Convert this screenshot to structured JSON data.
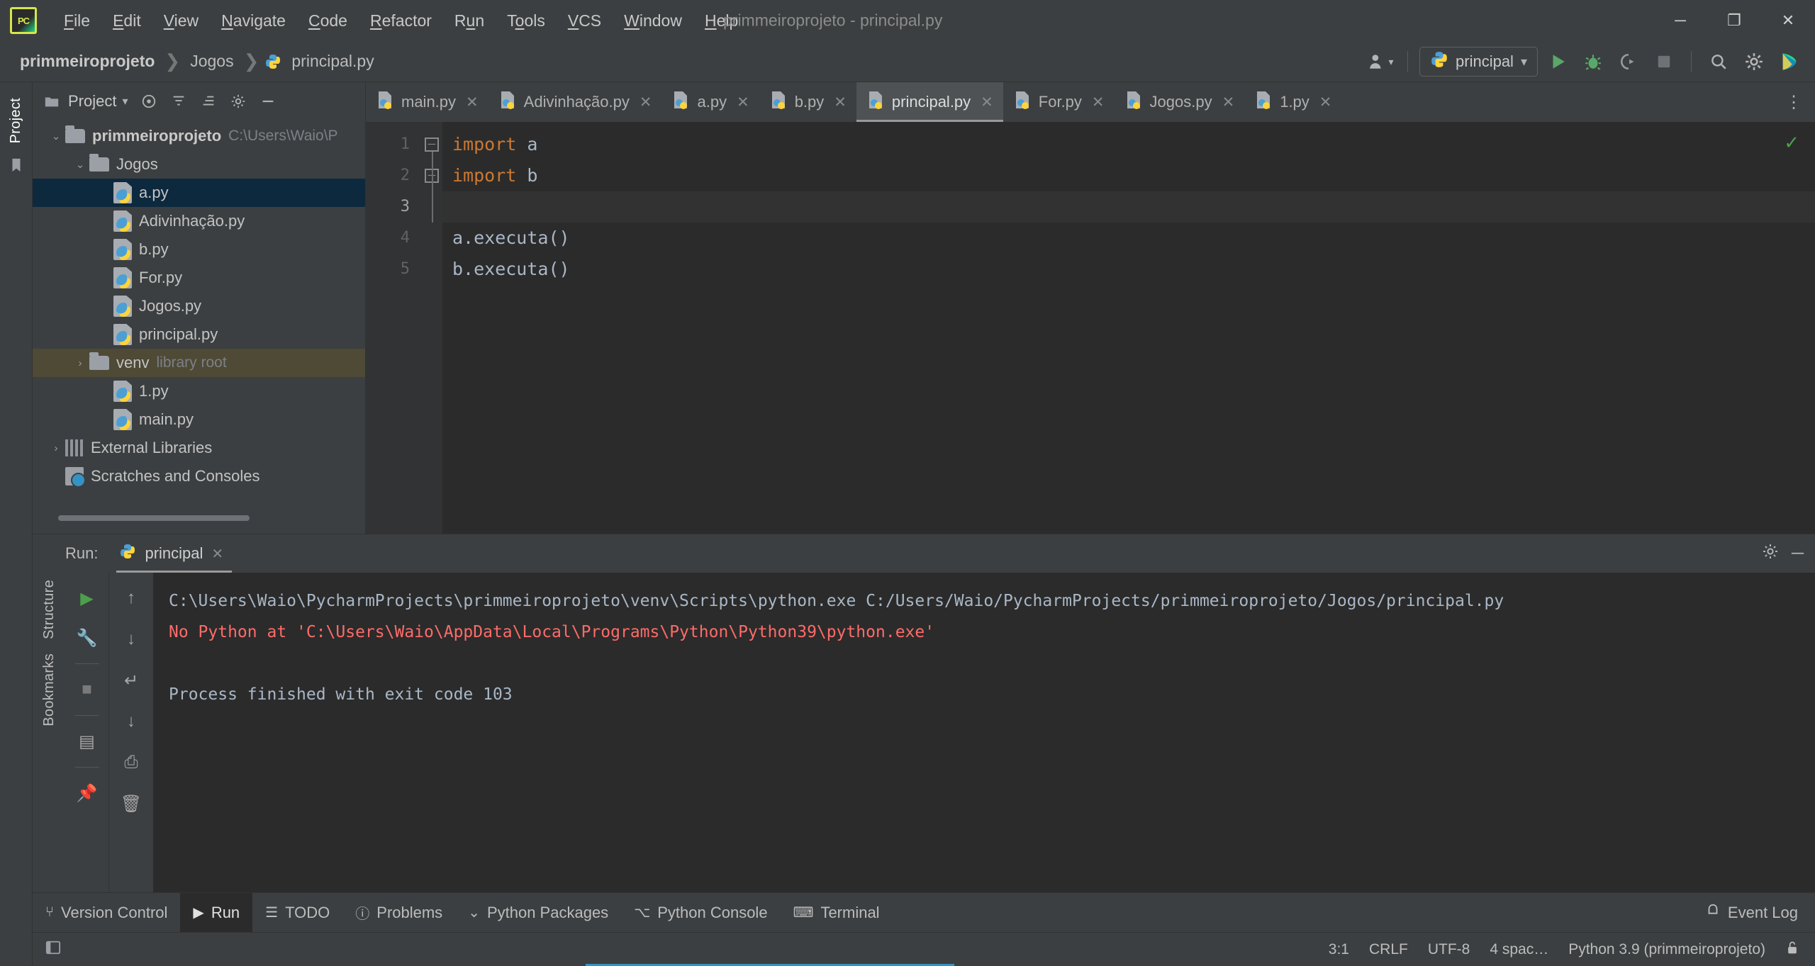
{
  "window": {
    "title": "primmeiroprojeto - principal.py",
    "logo_text": "PC",
    "minimize": "─",
    "maximize": "❐",
    "close": "✕"
  },
  "menu": {
    "items": [
      {
        "pre": "",
        "mn": "F",
        "post": "ile"
      },
      {
        "pre": "",
        "mn": "E",
        "post": "dit"
      },
      {
        "pre": "",
        "mn": "V",
        "post": "iew"
      },
      {
        "pre": "",
        "mn": "N",
        "post": "avigate"
      },
      {
        "pre": "",
        "mn": "C",
        "post": "ode"
      },
      {
        "pre": "",
        "mn": "R",
        "post": "efactor"
      },
      {
        "pre": "R",
        "mn": "u",
        "post": "n"
      },
      {
        "pre": "T",
        "mn": "o",
        "post": "ols"
      },
      {
        "pre": "",
        "mn": "V",
        "post": "CS"
      },
      {
        "pre": "",
        "mn": "W",
        "post": "indow"
      },
      {
        "pre": "",
        "mn": "H",
        "post": "elp"
      }
    ]
  },
  "breadcrumb": {
    "separator": "❯",
    "items": [
      "primmeiroprojeto",
      "Jogos",
      "principal.py"
    ]
  },
  "toolbar": {
    "account_icon": "account-icon",
    "run_config": "principal",
    "dropdown_caret": "▾",
    "run_icon": "▶",
    "debug_icon": "debug-bug-icon",
    "coverage_icon": "coverage-icon",
    "stop_icon": "■",
    "search_icon": "search-icon",
    "settings_icon": "gear-icon",
    "updates_icon": "updates-icon"
  },
  "left_strip": {
    "project_tab": "Project",
    "bookmark_icon": "bookmark-icon",
    "structure_tab": "Structure",
    "bookmarks_tab": "Bookmarks"
  },
  "project_panel": {
    "title": "Project",
    "caret": "▾",
    "icons": [
      "target-icon",
      "collapse-icon",
      "expand-icon",
      "gear-icon",
      "hide-icon"
    ],
    "tree": [
      {
        "indent": 0,
        "arrow": "⌄",
        "type": "folder",
        "label": "primmeiroprojeto",
        "bold": true,
        "sub": "C:\\Users\\Waio\\P",
        "state": "normal"
      },
      {
        "indent": 1,
        "arrow": "⌄",
        "type": "folder",
        "label": "Jogos",
        "bold": false,
        "sub": "",
        "state": "normal"
      },
      {
        "indent": 2,
        "arrow": "",
        "type": "py",
        "label": "a.py",
        "bold": false,
        "sub": "",
        "state": "selected"
      },
      {
        "indent": 2,
        "arrow": "",
        "type": "py",
        "label": "Adivinhação.py",
        "bold": false,
        "sub": "",
        "state": "normal"
      },
      {
        "indent": 2,
        "arrow": "",
        "type": "py",
        "label": "b.py",
        "bold": false,
        "sub": "",
        "state": "normal"
      },
      {
        "indent": 2,
        "arrow": "",
        "type": "py",
        "label": "For.py",
        "bold": false,
        "sub": "",
        "state": "normal"
      },
      {
        "indent": 2,
        "arrow": "",
        "type": "py",
        "label": "Jogos.py",
        "bold": false,
        "sub": "",
        "state": "normal"
      },
      {
        "indent": 2,
        "arrow": "",
        "type": "py",
        "label": "principal.py",
        "bold": false,
        "sub": "",
        "state": "normal"
      },
      {
        "indent": 1,
        "arrow": "›",
        "type": "folder",
        "label": "venv",
        "bold": false,
        "sub": "library root",
        "state": "hover"
      },
      {
        "indent": 2,
        "arrow": "",
        "type": "py",
        "label": "1.py",
        "bold": false,
        "sub": "",
        "state": "normal"
      },
      {
        "indent": 2,
        "arrow": "",
        "type": "py",
        "label": "main.py",
        "bold": false,
        "sub": "",
        "state": "normal"
      },
      {
        "indent": 0,
        "arrow": "›",
        "type": "libs",
        "label": "External Libraries",
        "bold": false,
        "sub": "",
        "state": "normal"
      },
      {
        "indent": 0,
        "arrow": "",
        "type": "scratch",
        "label": "Scratches and Consoles",
        "bold": false,
        "sub": "",
        "state": "normal"
      }
    ]
  },
  "editor": {
    "tabs": [
      {
        "label": "main.py",
        "active": false
      },
      {
        "label": "Adivinhação.py",
        "active": false
      },
      {
        "label": "a.py",
        "active": false
      },
      {
        "label": "b.py",
        "active": false
      },
      {
        "label": "principal.py",
        "active": true
      },
      {
        "label": "For.py",
        "active": false
      },
      {
        "label": "Jogos.py",
        "active": false
      },
      {
        "label": "1.py",
        "active": false
      }
    ],
    "tab_close": "✕",
    "more_icon": "⋮",
    "inspection_status": "✓",
    "line_numbers": [
      "1",
      "2",
      "3",
      "4",
      "5"
    ],
    "current_line": 3,
    "lines": [
      {
        "n": 1,
        "fold": "─",
        "tokens": [
          {
            "t": "import",
            "c": "kw"
          },
          {
            "t": " a",
            "c": ""
          }
        ]
      },
      {
        "n": 2,
        "fold": "─",
        "tokens": [
          {
            "t": "import",
            "c": "kw"
          },
          {
            "t": " b",
            "c": ""
          }
        ]
      },
      {
        "n": 3,
        "fold": "",
        "tokens": [
          {
            "t": "",
            "c": ""
          }
        ]
      },
      {
        "n": 4,
        "fold": "",
        "tokens": [
          {
            "t": "a.executa()",
            "c": ""
          }
        ]
      },
      {
        "n": 5,
        "fold": "",
        "tokens": [
          {
            "t": "b.executa()",
            "c": ""
          }
        ]
      }
    ]
  },
  "run_panel": {
    "label": "Run:",
    "tab_label": "principal",
    "tab_close": "✕",
    "settings_icon": "gear-icon",
    "hide_icon": "─",
    "left_tools": [
      {
        "name": "rerun-button",
        "glyph": "▶",
        "color": "#4c9f4c"
      },
      {
        "name": "configure-button",
        "glyph": "🔧",
        "color": "#a7a7a7"
      },
      {
        "name": "stop-button",
        "glyph": "■",
        "color": "#7a7a7a"
      },
      {
        "name": "layout-button",
        "glyph": "▤",
        "color": "#a7a7a7"
      },
      {
        "name": "pin-button",
        "glyph": "📌",
        "color": "#a7a7a7"
      }
    ],
    "right_tools": [
      {
        "name": "up-arrow-button",
        "glyph": "↑"
      },
      {
        "name": "down-arrow-button",
        "glyph": "↓"
      },
      {
        "name": "soft-wrap-button",
        "glyph": "↵"
      },
      {
        "name": "scroll-to-end-button",
        "glyph": "↓"
      },
      {
        "name": "print-button",
        "glyph": "⎙"
      },
      {
        "name": "clear-all-button",
        "glyph": "🗑"
      }
    ],
    "console_lines": [
      {
        "text": "C:\\Users\\Waio\\PycharmProjects\\primmeiroprojeto\\venv\\Scripts\\python.exe C:/Users/Waio/PycharmProjects/primmeiroprojeto/Jogos/principal.py",
        "error": false
      },
      {
        "text": "No Python at 'C:\\Users\\Waio\\AppData\\Local\\Programs\\Python\\Python39\\python.exe'",
        "error": true
      },
      {
        "text": "",
        "error": false
      },
      {
        "text": "Process finished with exit code 103",
        "error": false
      }
    ]
  },
  "bottom_bar": {
    "items": [
      {
        "label": "Version Control",
        "icon": "branch-icon",
        "glyph": "⑂",
        "active": false
      },
      {
        "label": "Run",
        "icon": "run-icon",
        "glyph": "▶",
        "active": true
      },
      {
        "label": "TODO",
        "icon": "list-icon",
        "glyph": "☰",
        "active": false
      },
      {
        "label": "Problems",
        "icon": "warning-icon",
        "glyph": "ⓘ",
        "active": false
      },
      {
        "label": "Python Packages",
        "icon": "packages-icon",
        "glyph": "⌄",
        "active": false
      },
      {
        "label": "Python Console",
        "icon": "python-icon",
        "glyph": "⌥",
        "active": false
      },
      {
        "label": "Terminal",
        "icon": "terminal-icon",
        "glyph": "⌨",
        "active": false
      }
    ],
    "event_log": "Event Log",
    "event_log_icon": "bell-icon"
  },
  "status_bar": {
    "caret_position": "3:1",
    "line_separator": "CRLF",
    "encoding": "UTF-8",
    "indent": "4 spac…",
    "interpreter": "Python 3.9 (primmeiroprojeto)",
    "lock_icon": "🔓"
  },
  "colors": {
    "panel_bg": "#3c3f41",
    "editor_bg": "#2b2b2b",
    "gutter_bg": "#313335",
    "selection": "#0d293e",
    "hover": "#4e4a36",
    "keyword": "#cc7832",
    "code_text": "#a9b7c6",
    "error": "#ff6b68",
    "accent": "#3592c4",
    "run_green": "#4c9f4c"
  }
}
